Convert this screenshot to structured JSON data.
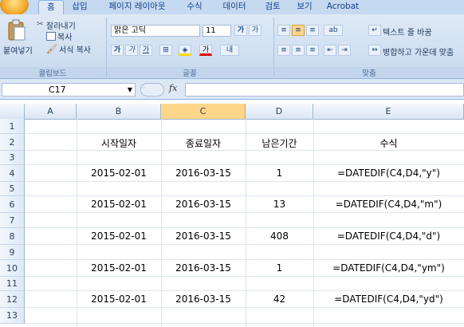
{
  "tabs": [
    "홈",
    "삽입",
    "페이지 레이아웃",
    "수식",
    "데이터",
    "검토",
    "보기",
    "Acrobat"
  ],
  "ribbon": {
    "clipboard": {
      "paste": "붙여넣기",
      "cut": "잘라내기",
      "copy": "복사",
      "format_painter": "서식 복사",
      "label": "클립보드"
    },
    "font": {
      "font_name": "맑은 고딕",
      "font_size": "11",
      "label": "글꼴"
    },
    "alignment": {
      "wrap_text": "텍스트 줄 바꿈",
      "merge_center": "병합하고 가운데 맞춤",
      "label": "맞춤"
    }
  },
  "formula_bar": {
    "name_box": "C17",
    "fx": "fx",
    "value": ""
  },
  "columns": [
    "A",
    "B",
    "C",
    "D",
    "E"
  ],
  "rows": [
    "1",
    "2",
    "3",
    "4",
    "5",
    "6",
    "7",
    "8",
    "9",
    "10",
    "11",
    "12",
    "13"
  ],
  "table": {
    "headers": [
      "시작일자",
      "종료일자",
      "남은기간",
      "수식"
    ],
    "data": [
      {
        "start": "2015-02-01",
        "end": "2016-03-15",
        "remaining": "1",
        "formula": "=DATEDIF(C4,D4,\"y\")"
      },
      {
        "start": "2015-02-01",
        "end": "2016-03-15",
        "remaining": "13",
        "formula": "=DATEDIF(C4,D4,\"m\")"
      },
      {
        "start": "2015-02-01",
        "end": "2016-03-15",
        "remaining": "408",
        "formula": "=DATEDIF(C4,D4,\"d\")"
      },
      {
        "start": "2015-02-01",
        "end": "2016-03-15",
        "remaining": "1",
        "formula": "=DATEDIF(C4,D4,\"ym\")"
      },
      {
        "start": "2015-02-01",
        "end": "2016-03-15",
        "remaining": "42",
        "formula": "=DATEDIF(C4,D4,\"yd\")"
      }
    ]
  }
}
